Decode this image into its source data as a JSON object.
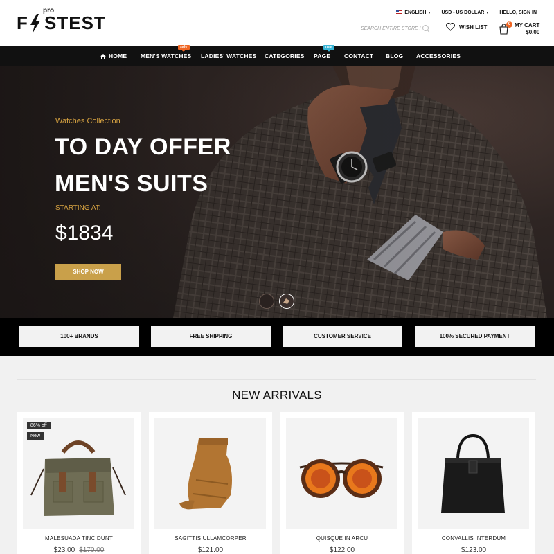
{
  "header": {
    "logo": {
      "f": "F",
      "rest": "STEST",
      "pro": "pro"
    },
    "top_links": {
      "language": "ENGLISH",
      "currency": "USD - US DOLLAR",
      "account": "HELLO, SIGN IN"
    },
    "search": {
      "placeholder": "SEARCH ENTIRE STORE H"
    },
    "wishlist": {
      "label": "WISH LIST",
      "icon": "heart-icon"
    },
    "cart": {
      "label": "MY CART",
      "total": "$0.00",
      "count": "0",
      "icon": "cart-icon"
    }
  },
  "nav": {
    "items": [
      {
        "label": "HOME",
        "icon": "home-icon"
      },
      {
        "label": "MEN'S WATCHES",
        "badge": "sale"
      },
      {
        "label": "LADIES' WATCHES"
      },
      {
        "label": "CATEGORIES"
      },
      {
        "label": "PAGE",
        "badge": "new"
      },
      {
        "label": "CONTACT"
      },
      {
        "label": "BLOG"
      },
      {
        "label": "ACCESSORIES"
      }
    ],
    "colors": {
      "sale": "#f06522",
      "new": "#38b6d7"
    }
  },
  "hero": {
    "subtitle": "Watches Collection",
    "title_line1": "TO DAY OFFER",
    "title_line2": "MEN'S SUITS",
    "starting_label": "STARTING AT:",
    "price": "$1834",
    "button": "SHOP NOW",
    "accent_color": "#c9a04a",
    "slides": 2,
    "active_slide": 2
  },
  "features": [
    "100+ BRANDS",
    "FREE SHIPPING",
    "CUSTOMER SERVICE",
    "100% SECURED PAYMENT"
  ],
  "new_arrivals": {
    "title": "NEW ARRIVALS",
    "products": [
      {
        "name": "MALESUADA TINCIDUNT",
        "price": "$23.00",
        "old_price": "$170.00",
        "discount": "86% off",
        "label": "New",
        "image": "canvas-bag"
      },
      {
        "name": "SAGITTIS ULLAMCORPER",
        "price": "$121.00",
        "image": "folded-trousers"
      },
      {
        "name": "QUISQUE IN ARCU",
        "price": "$122.00",
        "image": "sunglasses"
      },
      {
        "name": "CONVALLIS INTERDUM",
        "price": "$123.00",
        "image": "leather-tote"
      }
    ]
  }
}
